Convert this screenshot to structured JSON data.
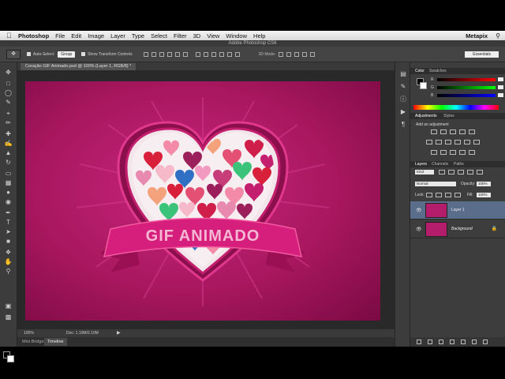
{
  "menubar": {
    "app": "Photoshop",
    "items": [
      "File",
      "Edit",
      "Image",
      "Layer",
      "Type",
      "Select",
      "Filter",
      "3D",
      "View",
      "Window",
      "Help"
    ],
    "right": "Metapix"
  },
  "window_title": "Adobe Photoshop CS6",
  "options": {
    "auto_select_label": "Auto-Select:",
    "auto_select_value": "Group",
    "transform_label": "Show Transform Controls",
    "mode_label": "3D Mode:",
    "workspace": "Essentials"
  },
  "document": {
    "tab_label": "Coração GIF Animado.psd @ 100% (Layer 1, RGB/8) *",
    "zoom": "100%",
    "doc_size": "Doc: 1.10M/2.10M",
    "artwork_text": "GIF ANIMADO"
  },
  "bottom_tabs": [
    "Mini Bridge",
    "Timeline"
  ],
  "color_panel": {
    "tabs": [
      "Color",
      "Swatches"
    ],
    "channels": [
      "R",
      "G",
      "B"
    ]
  },
  "adjustments_panel": {
    "tabs": [
      "Adjustments",
      "Styles"
    ],
    "heading": "Add an adjustment"
  },
  "layers_panel": {
    "tabs": [
      "Layers",
      "Channels",
      "Paths"
    ],
    "kind_filter": "Kind",
    "blend_mode": "Normal",
    "opacity_label": "Opacity:",
    "opacity_value": "100%",
    "lock_label": "Lock:",
    "fill_label": "Fill:",
    "fill_value": "100%",
    "layers": [
      {
        "name": "Layer 1",
        "selected": true
      },
      {
        "name": "Background",
        "selected": false
      }
    ]
  },
  "colors": {
    "canvas_magenta": "#b31d6c",
    "heart_red": "#e0245e",
    "ribbon_pink": "#d61f7c",
    "selection_blue": "#5a6e8c"
  }
}
